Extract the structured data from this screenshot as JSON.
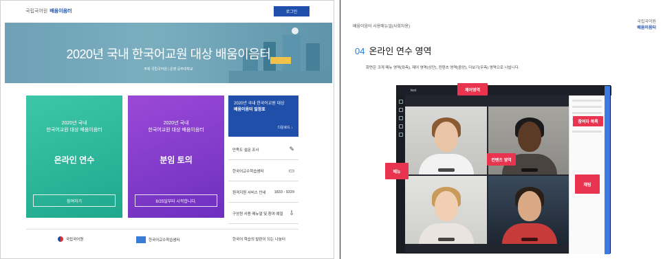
{
  "left": {
    "header": {
      "brand_org": "국립국어원",
      "brand_name": "배움이음터",
      "login_label": "로그인"
    },
    "hero": {
      "title": "2020년 국내 한국어교원 대상 배움이음터",
      "sub": "주최  국립국어원   |   운영  공주대학교"
    },
    "cards": [
      {
        "small_1": "2020년 국내",
        "small_2": "한국어교원 대상 배움이음터",
        "big": "온라인 연수",
        "button": "참여하기"
      },
      {
        "small_1": "2020년 국내",
        "small_2": "한국어교원 대상 배움이음터",
        "big": "분임 토의",
        "button": "8/25일부터 시작합니다."
      }
    ],
    "side": {
      "blue_line1": "2020년 국내 한국어교원 대상",
      "blue_line2": "배움이음터 일정표",
      "download": "다운로드 ↓",
      "rows": [
        {
          "label": "만족도 설문 조사",
          "icon": "✎"
        },
        {
          "label": "한국어교수학습샘터",
          "icon": "▭"
        },
        {
          "label": "원격지원 서비스 안내",
          "value": "1833 - 9229"
        },
        {
          "label": "구성원 사용 매뉴얼 및 참여 예절",
          "icon": "⇩"
        }
      ]
    },
    "partners": [
      {
        "name": "국립국어원"
      },
      {
        "name": "한국어교수학습샘터"
      },
      {
        "name": "한국어 학습의 발판이 되는 나눔터"
      }
    ]
  },
  "right": {
    "breadcrumb": "배움이음터 사용매뉴얼(사회자용)",
    "brand_org": "국립국어원",
    "brand_name": "배움이음터",
    "heading_num": "04",
    "heading": "온라인 연수 영역",
    "description": "화면은 크게 메뉴 영역(좌측), 제어 영역(상단), 컨텐츠 영역(중앙), 더보기(우측) 영역으로 나뉩니다.",
    "app_tab": "test",
    "labels": {
      "control": "제어영역",
      "participants": "참여자 목록",
      "contents": "컨텐츠 영역",
      "menu": "메뉴",
      "chat": "채팅"
    }
  },
  "colors": {
    "brand_blue": "#1f4fa8",
    "green": "#2cb89a",
    "purple": "#8a3fd0",
    "label_red": "#e8344e"
  }
}
